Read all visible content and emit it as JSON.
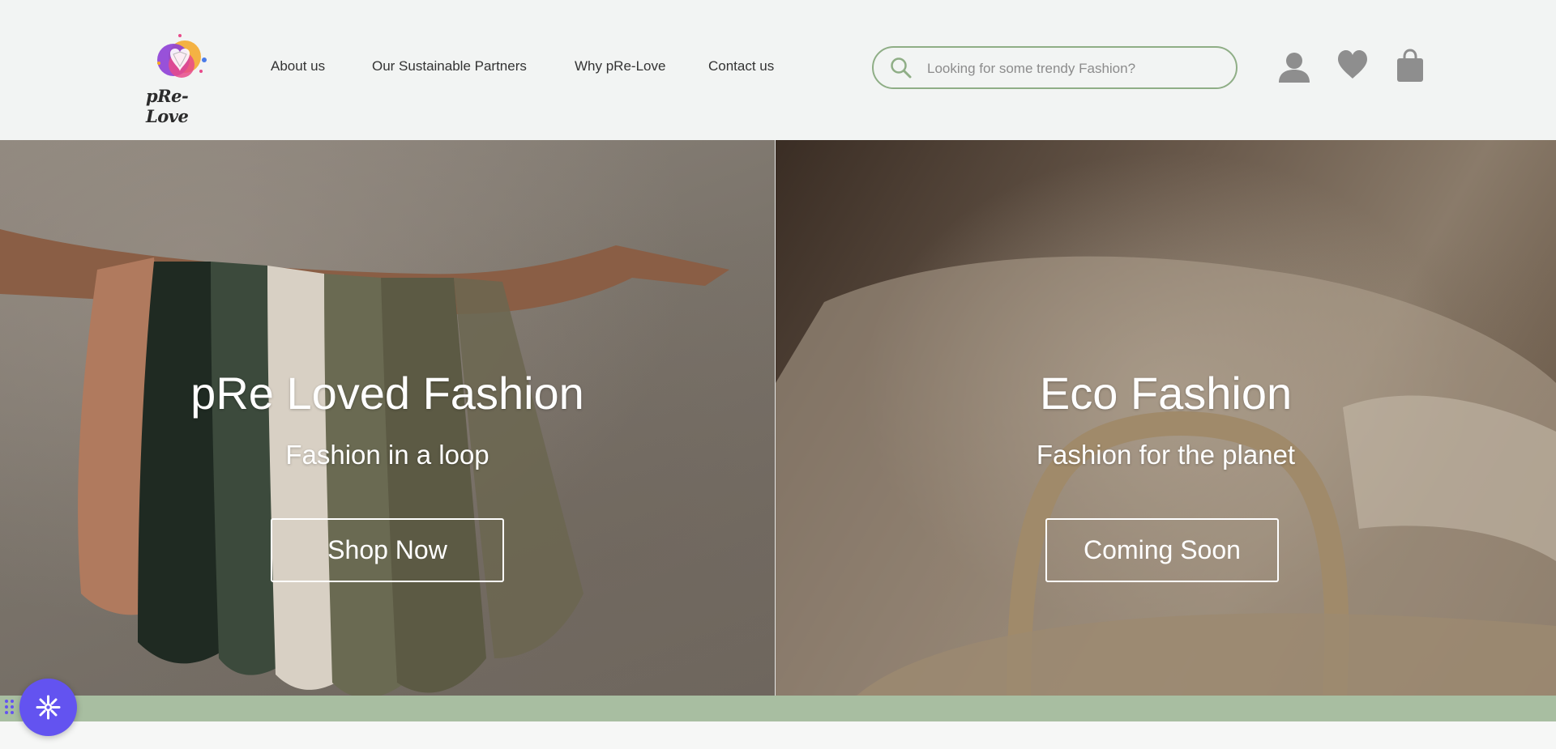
{
  "brand": {
    "logo_text": "pRe-Love"
  },
  "nav": {
    "items": [
      {
        "label": "About us"
      },
      {
        "label": "Our Sustainable Partners"
      },
      {
        "label": "Why pRe-Love"
      },
      {
        "label": "Contact us"
      }
    ]
  },
  "search": {
    "placeholder": "Looking for some trendy Fashion?",
    "value": ""
  },
  "header_icons": [
    "user-icon",
    "heart-icon",
    "shopping-bag-icon"
  ],
  "hero": {
    "panels": [
      {
        "title": "pRe Loved Fashion",
        "subtitle": "Fashion in a loop",
        "button": "Shop Now"
      },
      {
        "title": "Eco Fashion",
        "subtitle": "Fashion for the planet",
        "button": "Coming Soon"
      }
    ]
  },
  "colors": {
    "accent_green": "#a8bea1",
    "search_border": "#8fae86",
    "icon_gray": "#8e8e8e",
    "widget_purple": "#6353f0"
  }
}
